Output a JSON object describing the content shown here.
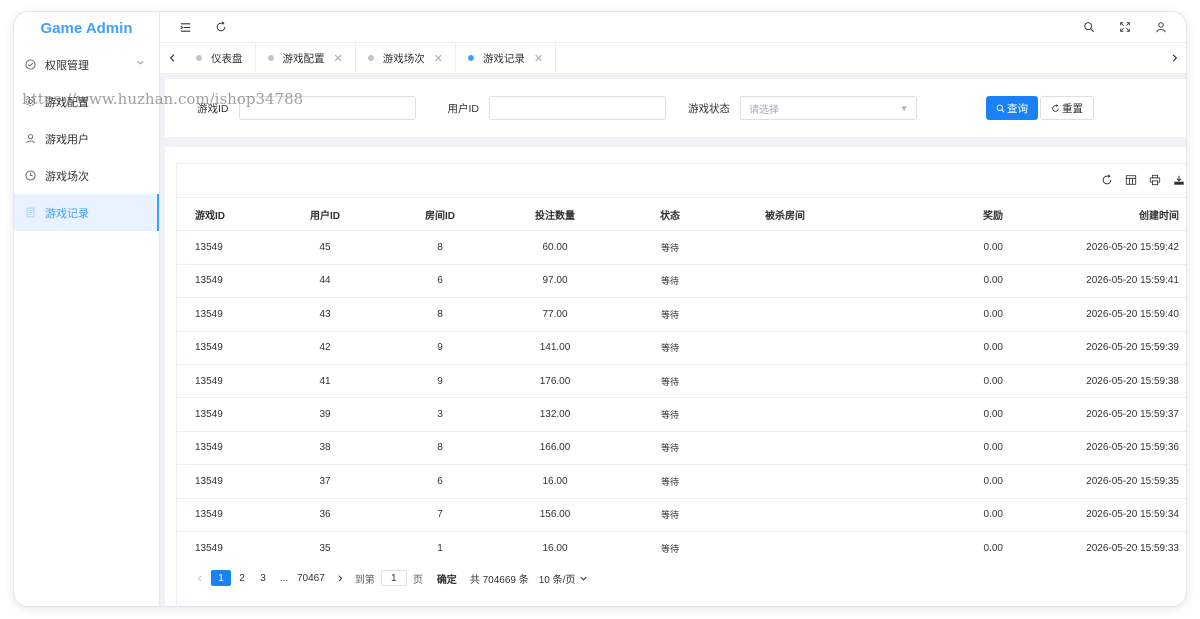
{
  "app": {
    "title": "Game Admin"
  },
  "sidebar": {
    "items": [
      {
        "label": "权限管理",
        "icon": "shield-check-icon",
        "has_arrow": true
      },
      {
        "label": "游戏配置",
        "icon": "gear-icon"
      },
      {
        "label": "游戏用户",
        "icon": "user-icon"
      },
      {
        "label": "游戏场次",
        "icon": "clock-icon"
      },
      {
        "label": "游戏记录",
        "icon": "document-icon",
        "active": true
      }
    ]
  },
  "watermark": "https://www.huzhan.com/ishop34788",
  "tabs": [
    {
      "label": "仪表盘",
      "closable": false,
      "active": false
    },
    {
      "label": "游戏配置",
      "closable": true,
      "active": false
    },
    {
      "label": "游戏场次",
      "closable": true,
      "active": false
    },
    {
      "label": "游戏记录",
      "closable": true,
      "active": true
    }
  ],
  "search": {
    "game_id_label": "游戏ID",
    "user_id_label": "用户ID",
    "status_label": "游戏状态",
    "status_placeholder": "请选择",
    "query_button": "查询",
    "reset_button": "重置"
  },
  "table": {
    "columns": [
      "游戏ID",
      "用户ID",
      "房间ID",
      "投注数量",
      "状态",
      "被杀房间",
      "奖励",
      "创建时间"
    ],
    "rows": [
      [
        "13549",
        "45",
        "8",
        "60.00",
        "等待",
        "",
        "0.00",
        "2026-05-20 15:59:42"
      ],
      [
        "13549",
        "44",
        "6",
        "97.00",
        "等待",
        "",
        "0.00",
        "2026-05-20 15:59:41"
      ],
      [
        "13549",
        "43",
        "8",
        "77.00",
        "等待",
        "",
        "0.00",
        "2026-05-20 15:59:40"
      ],
      [
        "13549",
        "42",
        "9",
        "141.00",
        "等待",
        "",
        "0.00",
        "2026-05-20 15:59:39"
      ],
      [
        "13549",
        "41",
        "9",
        "176.00",
        "等待",
        "",
        "0.00",
        "2026-05-20 15:59:38"
      ],
      [
        "13549",
        "39",
        "3",
        "132.00",
        "等待",
        "",
        "0.00",
        "2026-05-20 15:59:37"
      ],
      [
        "13549",
        "38",
        "8",
        "166.00",
        "等待",
        "",
        "0.00",
        "2026-05-20 15:59:36"
      ],
      [
        "13549",
        "37",
        "6",
        "16.00",
        "等待",
        "",
        "0.00",
        "2026-05-20 15:59:35"
      ],
      [
        "13549",
        "36",
        "7",
        "156.00",
        "等待",
        "",
        "0.00",
        "2026-05-20 15:59:34"
      ],
      [
        "13549",
        "35",
        "1",
        "16.00",
        "等待",
        "",
        "0.00",
        "2026-05-20 15:59:33"
      ]
    ]
  },
  "pagination": {
    "pages": [
      "1",
      "2",
      "3"
    ],
    "ellipsis": "...",
    "last_page": "70467",
    "goto_prefix": "到第",
    "goto_value": "1",
    "goto_suffix": "页",
    "confirm": "确定",
    "total": "共 704669 条",
    "page_size": "10 条/页"
  },
  "colors": {
    "accent": "#409eff",
    "primary_button": "#1b82f6"
  }
}
